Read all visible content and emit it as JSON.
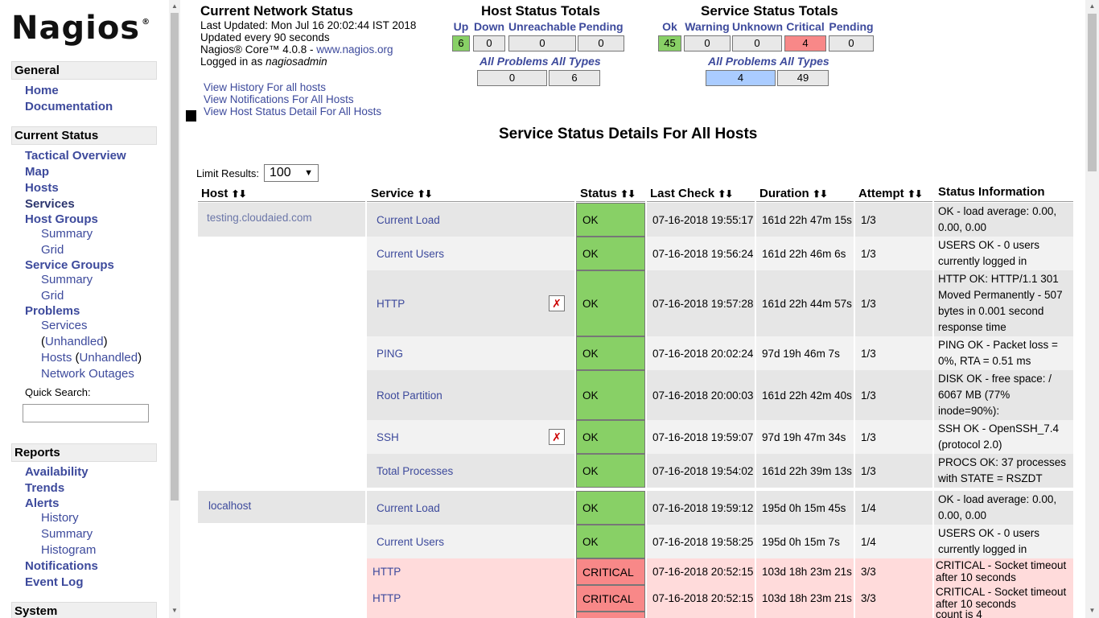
{
  "sidebar": {
    "logo": "Nagios",
    "logo_mark": "®",
    "general": {
      "title": "General",
      "home": "Home",
      "documentation": "Documentation"
    },
    "current_status": {
      "title": "Current Status",
      "tactical": "Tactical Overview",
      "map": "Map",
      "hosts": "Hosts",
      "services": "Services",
      "host_groups": "Host Groups",
      "hg_summary": "Summary",
      "hg_grid": "Grid",
      "service_groups": "Service Groups",
      "sg_summary": "Summary",
      "sg_grid": "Grid",
      "problems": "Problems",
      "p_services": "Services",
      "p_services_unhandled": "Unhandled",
      "p_hosts": "Hosts",
      "p_hosts_unhandled": "Unhandled",
      "p_network_outages": "Network Outages",
      "quick_search_label": "Quick Search:"
    },
    "reports": {
      "title": "Reports",
      "availability": "Availability",
      "trends": "Trends",
      "alerts": "Alerts",
      "a_history": "History",
      "a_summary": "Summary",
      "a_histogram": "Histogram",
      "notifications": "Notifications",
      "event_log": "Event Log"
    },
    "system": {
      "title": "System"
    }
  },
  "info": {
    "title": "Current Network Status",
    "last_updated": "Last Updated: Mon Jul 16 20:02:44 IST 2018",
    "update_interval": "Updated every 90 seconds",
    "core_prefix": "Nagios® Core™ 4.0.8 - ",
    "core_link": "www.nagios.org",
    "logged_prefix": "Logged in as ",
    "logged_user": "nagiosadmin",
    "links": [
      "View History For all hosts",
      "View Notifications For All Hosts",
      "View Host Status Detail For All Hosts"
    ]
  },
  "host_totals": {
    "title": "Host Status Totals",
    "headers": [
      "Up",
      "Down",
      "Unreachable",
      "Pending"
    ],
    "values": [
      "6",
      "0",
      "0",
      "0"
    ],
    "all_problems_label": "All Problems",
    "all_types_label": "All Types",
    "all_problems": "0",
    "all_types": "6"
  },
  "service_totals": {
    "title": "Service Status Totals",
    "headers": [
      "Ok",
      "Warning",
      "Unknown",
      "Critical",
      "Pending"
    ],
    "values": [
      "45",
      "0",
      "0",
      "4",
      "0"
    ],
    "all_problems_label": "All Problems",
    "all_types_label": "All Types",
    "all_problems": "4",
    "all_types": "49"
  },
  "colors": {
    "ok": "#88d066",
    "critical": "#f88888",
    "problems_highlight": "#aaccff",
    "link": "#3d4a9c"
  },
  "page_heading": "Service Status Details For All Hosts",
  "limit": {
    "label": "Limit Results:",
    "value": "100"
  },
  "columns": [
    "Host",
    "Service",
    "Status",
    "Last Check",
    "Duration",
    "Attempt",
    "Status Information"
  ],
  "rows": [
    {
      "host": "testing.cloudaied.com",
      "service": "Current Load",
      "status": "OK",
      "last_check": "07-16-2018 19:55:17",
      "duration": "161d 22h 47m 15s",
      "attempt": "1/3",
      "info": "OK - load average: 0.00, 0.00, 0.00"
    },
    {
      "host": "",
      "service": "Current Users",
      "status": "OK",
      "last_check": "07-16-2018 19:56:24",
      "duration": "161d 22h 46m 6s",
      "attempt": "1/3",
      "info": "USERS OK - 0 users currently logged in"
    },
    {
      "host": "",
      "service": "HTTP",
      "status": "OK",
      "last_check": "07-16-2018 19:57:28",
      "duration": "161d 22h 44m 57s",
      "attempt": "1/3",
      "info": "HTTP OK: HTTP/1.1 301 Moved Permanently - 507 bytes in 0.001 second response time",
      "icon": "notifications-disabled-icon"
    },
    {
      "host": "",
      "service": "PING",
      "status": "OK",
      "last_check": "07-16-2018 20:02:24",
      "duration": "97d 19h 46m 7s",
      "attempt": "1/3",
      "info": "PING OK - Packet loss = 0%, RTA = 0.51 ms"
    },
    {
      "host": "",
      "service": "Root Partition",
      "status": "OK",
      "last_check": "07-16-2018 20:00:03",
      "duration": "161d 22h 42m 40s",
      "attempt": "1/3",
      "info": "DISK OK - free space: / 6067 MB (77% inode=90%):"
    },
    {
      "host": "",
      "service": "SSH",
      "status": "OK",
      "last_check": "07-16-2018 19:59:07",
      "duration": "97d 19h 47m 34s",
      "attempt": "1/3",
      "info": "SSH OK - OpenSSH_7.4 (protocol 2.0)",
      "icon": "notifications-disabled-icon"
    },
    {
      "host": "",
      "service": "Total Processes",
      "status": "OK",
      "last_check": "07-16-2018 19:54:02",
      "duration": "161d 22h 39m 13s",
      "attempt": "1/3",
      "info": "PROCS OK: 37 processes with STATE = RSZDT"
    },
    {
      "host": "localhost",
      "service": "Current Load",
      "status": "OK",
      "last_check": "07-16-2018 19:59:12",
      "duration": "195d 0h 15m 45s",
      "attempt": "1/4",
      "info": "OK - load average: 0.00, 0.00, 0.00"
    },
    {
      "host": "",
      "service": "Current Users",
      "status": "OK",
      "last_check": "07-16-2018 19:58:25",
      "duration": "195d 0h 15m 7s",
      "attempt": "1/4",
      "info": "USERS OK - 0 users currently logged in"
    },
    {
      "host": "",
      "service": "HTTP",
      "status": "CRITICAL",
      "last_check": "07-16-2018 20:52:15",
      "duration": "103d 18h 23m 21s",
      "attempt": "3/3",
      "info": "CRITICAL - Socket timeout after 10 seconds"
    },
    {
      "host": "",
      "service": "HTTP",
      "status": "CRITICAL",
      "last_check": "07-16-2018 20:52:15",
      "duration": "103d 18h 23m 21s",
      "attempt": "3/3",
      "info": "CRITICAL - Socket timeout after 10 seconds"
    },
    {
      "host": "",
      "service": "",
      "status": "",
      "last_check": "",
      "duration": "",
      "attempt": "",
      "info": "count is 4"
    }
  ]
}
